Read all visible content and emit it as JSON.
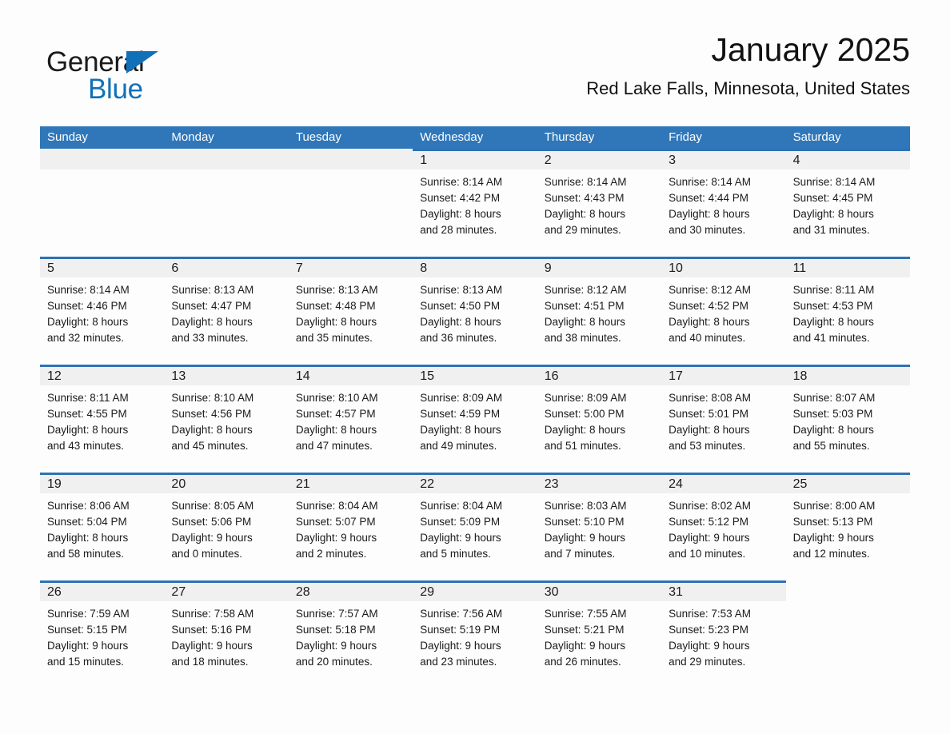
{
  "logo": {
    "word_one": "General",
    "word_two": "Blue",
    "triangle_color": "#1270b8",
    "text_color": "#1b1b1b"
  },
  "header": {
    "title": "January 2025",
    "subtitle": "Red Lake Falls, Minnesota, United States"
  },
  "theme": {
    "header_bar": "#3077b9",
    "row_rule": "#2e72b4",
    "daynum_strip": "#f0f0f0",
    "page_bg": "#fdfdfd",
    "text": "#1b1b1b"
  },
  "weekdays": [
    "Sunday",
    "Monday",
    "Tuesday",
    "Wednesday",
    "Thursday",
    "Friday",
    "Saturday"
  ],
  "weeks": [
    [
      {
        "blank": true,
        "lead": true
      },
      {
        "blank": true,
        "lead": true
      },
      {
        "blank": true,
        "lead": true
      },
      {
        "day": "1",
        "sunrise": "Sunrise: 8:14 AM",
        "sunset": "Sunset: 4:42 PM",
        "daylight1": "Daylight: 8 hours",
        "daylight2": "and 28 minutes."
      },
      {
        "day": "2",
        "sunrise": "Sunrise: 8:14 AM",
        "sunset": "Sunset: 4:43 PM",
        "daylight1": "Daylight: 8 hours",
        "daylight2": "and 29 minutes."
      },
      {
        "day": "3",
        "sunrise": "Sunrise: 8:14 AM",
        "sunset": "Sunset: 4:44 PM",
        "daylight1": "Daylight: 8 hours",
        "daylight2": "and 30 minutes."
      },
      {
        "day": "4",
        "sunrise": "Sunrise: 8:14 AM",
        "sunset": "Sunset: 4:45 PM",
        "daylight1": "Daylight: 8 hours",
        "daylight2": "and 31 minutes."
      }
    ],
    [
      {
        "day": "5",
        "sunrise": "Sunrise: 8:14 AM",
        "sunset": "Sunset: 4:46 PM",
        "daylight1": "Daylight: 8 hours",
        "daylight2": "and 32 minutes."
      },
      {
        "day": "6",
        "sunrise": "Sunrise: 8:13 AM",
        "sunset": "Sunset: 4:47 PM",
        "daylight1": "Daylight: 8 hours",
        "daylight2": "and 33 minutes."
      },
      {
        "day": "7",
        "sunrise": "Sunrise: 8:13 AM",
        "sunset": "Sunset: 4:48 PM",
        "daylight1": "Daylight: 8 hours",
        "daylight2": "and 35 minutes."
      },
      {
        "day": "8",
        "sunrise": "Sunrise: 8:13 AM",
        "sunset": "Sunset: 4:50 PM",
        "daylight1": "Daylight: 8 hours",
        "daylight2": "and 36 minutes."
      },
      {
        "day": "9",
        "sunrise": "Sunrise: 8:12 AM",
        "sunset": "Sunset: 4:51 PM",
        "daylight1": "Daylight: 8 hours",
        "daylight2": "and 38 minutes."
      },
      {
        "day": "10",
        "sunrise": "Sunrise: 8:12 AM",
        "sunset": "Sunset: 4:52 PM",
        "daylight1": "Daylight: 8 hours",
        "daylight2": "and 40 minutes."
      },
      {
        "day": "11",
        "sunrise": "Sunrise: 8:11 AM",
        "sunset": "Sunset: 4:53 PM",
        "daylight1": "Daylight: 8 hours",
        "daylight2": "and 41 minutes."
      }
    ],
    [
      {
        "day": "12",
        "sunrise": "Sunrise: 8:11 AM",
        "sunset": "Sunset: 4:55 PM",
        "daylight1": "Daylight: 8 hours",
        "daylight2": "and 43 minutes."
      },
      {
        "day": "13",
        "sunrise": "Sunrise: 8:10 AM",
        "sunset": "Sunset: 4:56 PM",
        "daylight1": "Daylight: 8 hours",
        "daylight2": "and 45 minutes."
      },
      {
        "day": "14",
        "sunrise": "Sunrise: 8:10 AM",
        "sunset": "Sunset: 4:57 PM",
        "daylight1": "Daylight: 8 hours",
        "daylight2": "and 47 minutes."
      },
      {
        "day": "15",
        "sunrise": "Sunrise: 8:09 AM",
        "sunset": "Sunset: 4:59 PM",
        "daylight1": "Daylight: 8 hours",
        "daylight2": "and 49 minutes."
      },
      {
        "day": "16",
        "sunrise": "Sunrise: 8:09 AM",
        "sunset": "Sunset: 5:00 PM",
        "daylight1": "Daylight: 8 hours",
        "daylight2": "and 51 minutes."
      },
      {
        "day": "17",
        "sunrise": "Sunrise: 8:08 AM",
        "sunset": "Sunset: 5:01 PM",
        "daylight1": "Daylight: 8 hours",
        "daylight2": "and 53 minutes."
      },
      {
        "day": "18",
        "sunrise": "Sunrise: 8:07 AM",
        "sunset": "Sunset: 5:03 PM",
        "daylight1": "Daylight: 8 hours",
        "daylight2": "and 55 minutes."
      }
    ],
    [
      {
        "day": "19",
        "sunrise": "Sunrise: 8:06 AM",
        "sunset": "Sunset: 5:04 PM",
        "daylight1": "Daylight: 8 hours",
        "daylight2": "and 58 minutes."
      },
      {
        "day": "20",
        "sunrise": "Sunrise: 8:05 AM",
        "sunset": "Sunset: 5:06 PM",
        "daylight1": "Daylight: 9 hours",
        "daylight2": "and 0 minutes."
      },
      {
        "day": "21",
        "sunrise": "Sunrise: 8:04 AM",
        "sunset": "Sunset: 5:07 PM",
        "daylight1": "Daylight: 9 hours",
        "daylight2": "and 2 minutes."
      },
      {
        "day": "22",
        "sunrise": "Sunrise: 8:04 AM",
        "sunset": "Sunset: 5:09 PM",
        "daylight1": "Daylight: 9 hours",
        "daylight2": "and 5 minutes."
      },
      {
        "day": "23",
        "sunrise": "Sunrise: 8:03 AM",
        "sunset": "Sunset: 5:10 PM",
        "daylight1": "Daylight: 9 hours",
        "daylight2": "and 7 minutes."
      },
      {
        "day": "24",
        "sunrise": "Sunrise: 8:02 AM",
        "sunset": "Sunset: 5:12 PM",
        "daylight1": "Daylight: 9 hours",
        "daylight2": "and 10 minutes."
      },
      {
        "day": "25",
        "sunrise": "Sunrise: 8:00 AM",
        "sunset": "Sunset: 5:13 PM",
        "daylight1": "Daylight: 9 hours",
        "daylight2": "and 12 minutes."
      }
    ],
    [
      {
        "day": "26",
        "sunrise": "Sunrise: 7:59 AM",
        "sunset": "Sunset: 5:15 PM",
        "daylight1": "Daylight: 9 hours",
        "daylight2": "and 15 minutes."
      },
      {
        "day": "27",
        "sunrise": "Sunrise: 7:58 AM",
        "sunset": "Sunset: 5:16 PM",
        "daylight1": "Daylight: 9 hours",
        "daylight2": "and 18 minutes."
      },
      {
        "day": "28",
        "sunrise": "Sunrise: 7:57 AM",
        "sunset": "Sunset: 5:18 PM",
        "daylight1": "Daylight: 9 hours",
        "daylight2": "and 20 minutes."
      },
      {
        "day": "29",
        "sunrise": "Sunrise: 7:56 AM",
        "sunset": "Sunset: 5:19 PM",
        "daylight1": "Daylight: 9 hours",
        "daylight2": "and 23 minutes."
      },
      {
        "day": "30",
        "sunrise": "Sunrise: 7:55 AM",
        "sunset": "Sunset: 5:21 PM",
        "daylight1": "Daylight: 9 hours",
        "daylight2": "and 26 minutes."
      },
      {
        "day": "31",
        "sunrise": "Sunrise: 7:53 AM",
        "sunset": "Sunset: 5:23 PM",
        "daylight1": "Daylight: 9 hours",
        "daylight2": "and 29 minutes."
      },
      {
        "blank": true
      }
    ]
  ]
}
